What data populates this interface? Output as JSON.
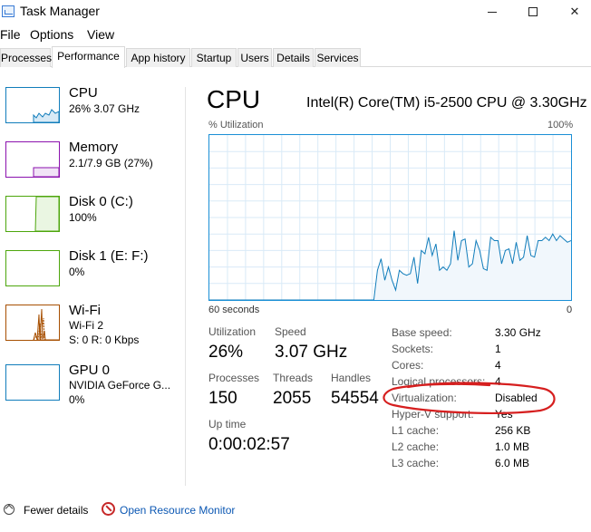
{
  "window": {
    "title": "Task Manager",
    "minimize_icon": "minimize-icon",
    "maximize_icon": "maximize-icon",
    "close_glyph": "✕"
  },
  "menu": {
    "file": "File",
    "options": "Options",
    "view": "View"
  },
  "tabs": [
    {
      "label": "Processes"
    },
    {
      "label": "Performance",
      "active": true
    },
    {
      "label": "App history"
    },
    {
      "label": "Startup"
    },
    {
      "label": "Users"
    },
    {
      "label": "Details"
    },
    {
      "label": "Services"
    }
  ],
  "sidebar": {
    "items": [
      {
        "name": "CPU",
        "sub1": "26%  3.07 GHz",
        "color": "#117dbb",
        "fill_percent": 26
      },
      {
        "name": "Memory",
        "sub1": "2.1/7.9 GB (27%)",
        "color": "#8b12ae",
        "fill_percent": 27
      },
      {
        "name": "Disk 0 (C:)",
        "sub1": "100%",
        "color": "#4da60c",
        "fill_percent": 100
      },
      {
        "name": "Disk 1 (E: F:)",
        "sub1": "0%",
        "color": "#4da60c",
        "fill_percent": 0
      },
      {
        "name": "Wi-Fi",
        "sub1": "Wi-Fi 2",
        "sub2": "S: 0  R: 0 Kbps",
        "color": "#a74f01"
      },
      {
        "name": "GPU 0",
        "sub1": "NVIDIA GeForce G...",
        "sub2": "0%",
        "color": "#117dbb",
        "fill_percent": 0
      }
    ]
  },
  "cpu": {
    "title": "CPU",
    "model": "Intel(R) Core(TM) i5-2500 CPU @ 3.30GHz",
    "util_label": "% Utilization",
    "util_max": "100%",
    "time_left": "60 seconds",
    "time_right": "0",
    "graph_color": "#117dbb",
    "graph_history_percent": [
      0,
      0,
      0,
      0,
      0,
      0,
      0,
      0,
      0,
      0,
      0,
      0,
      0,
      0,
      0,
      0,
      0,
      0,
      0,
      0,
      0,
      0,
      0,
      0,
      0,
      0,
      0,
      0,
      0,
      0,
      0,
      0,
      0,
      0,
      0,
      0,
      0,
      0,
      0,
      0,
      0,
      0,
      0,
      0,
      0,
      0,
      18,
      25,
      12,
      20,
      12,
      6,
      18,
      16,
      15,
      16,
      26,
      10,
      30,
      28,
      38,
      27,
      34,
      18,
      20,
      18,
      22,
      42,
      24,
      36,
      37,
      20,
      22,
      36,
      30,
      19,
      18,
      38,
      36,
      36,
      22,
      30,
      31,
      22,
      35,
      24,
      26,
      39,
      27,
      26,
      36,
      36,
      38,
      36,
      40,
      36,
      39,
      37,
      35,
      36
    ],
    "stats": {
      "utilization_label": "Utilization",
      "utilization": "26%",
      "speed_label": "Speed",
      "speed": "3.07 GHz",
      "processes_label": "Processes",
      "processes": "150",
      "threads_label": "Threads",
      "threads": "2055",
      "handles_label": "Handles",
      "handles": "54554",
      "uptime_label": "Up time",
      "uptime": "0:00:02:57"
    },
    "details": [
      {
        "key": "Base speed:",
        "value": "3.30 GHz"
      },
      {
        "key": "Sockets:",
        "value": "1"
      },
      {
        "key": "Cores:",
        "value": "4"
      },
      {
        "key": "Logical processors:",
        "value": "4"
      },
      {
        "key": "Virtualization:",
        "value": "Disabled"
      },
      {
        "key": "Hyper-V support:",
        "value": "Yes"
      },
      {
        "key": "L1 cache:",
        "value": "256 KB"
      },
      {
        "key": "L2 cache:",
        "value": "1.0 MB"
      },
      {
        "key": "L3 cache:",
        "value": "6.0 MB"
      }
    ],
    "annotation_color": "#d61f1f"
  },
  "footer": {
    "fewer_details": "Fewer details",
    "open_monitor": "Open Resource Monitor"
  }
}
